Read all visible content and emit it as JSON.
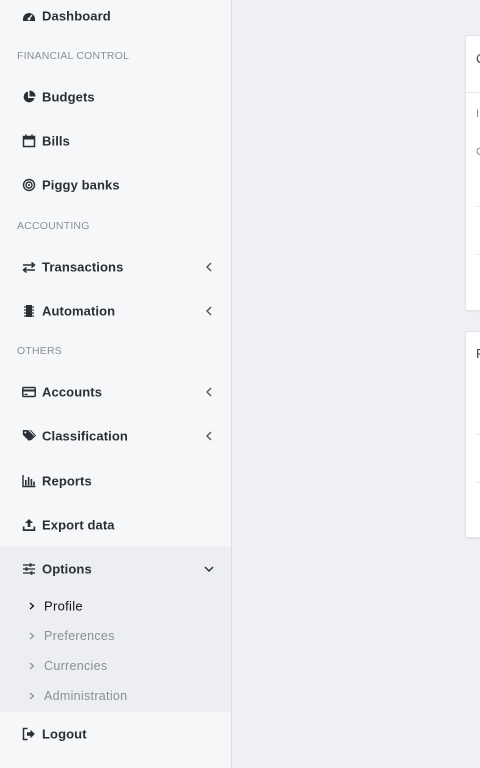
{
  "sidebar": {
    "dashboard": "Dashboard",
    "sections": {
      "financial_control": "FINANCIAL CONTROL",
      "accounting": "ACCOUNTING",
      "others": "OTHERS"
    },
    "items": {
      "budgets": "Budgets",
      "bills": "Bills",
      "piggy_banks": "Piggy banks",
      "transactions": "Transactions",
      "automation": "Automation",
      "accounts": "Accounts",
      "classification": "Classification",
      "reports": "Reports",
      "export_data": "Export data",
      "options": "Options",
      "logout": "Logout"
    },
    "options_submenu": {
      "profile": "Profile",
      "preferences": "Preferences",
      "currencies": "Currencies",
      "administration": "Administration"
    }
  },
  "colors": {
    "sidebar_bg": "#f6f7f9",
    "submenu_bg": "#eceef1",
    "content_bg": "#eef0f4",
    "text_primary": "#2a2e35",
    "text_muted": "#8a8f96"
  },
  "cards": {
    "card1": {
      "title_fragment": "C",
      "line1_fragment": "I",
      "line2_fragment": "C"
    },
    "card2": {
      "title_fragment": "F"
    }
  }
}
